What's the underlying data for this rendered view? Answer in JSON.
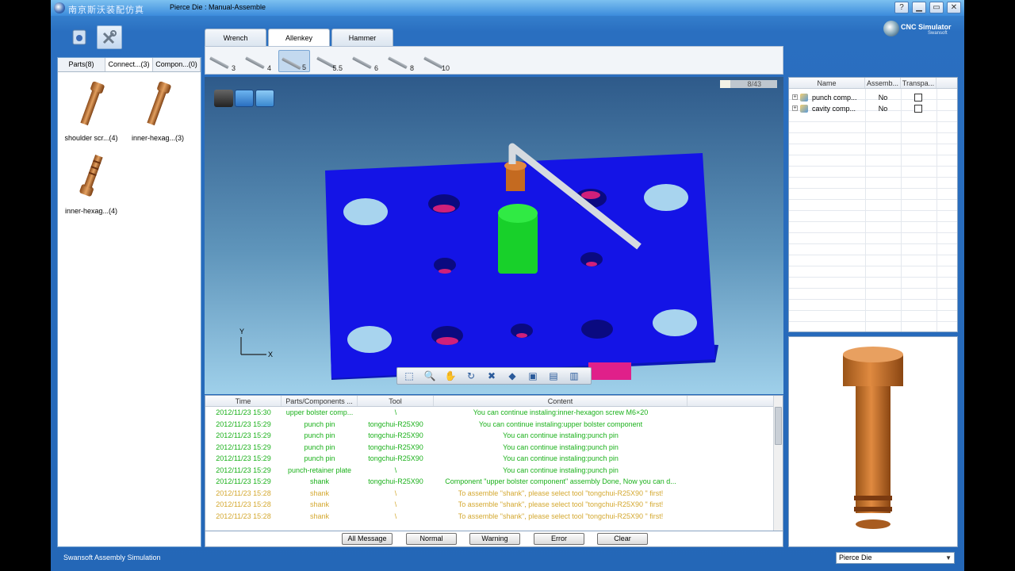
{
  "window": {
    "app_name_cn": "南京斯沃装配仿真",
    "title": "Pierce Die : Manual-Assemble",
    "title_buttons": [
      "help-icon",
      "minimize-icon",
      "maximize-icon",
      "close-icon"
    ]
  },
  "brand": {
    "name": "CNC Simulator",
    "sub": "Swansoft"
  },
  "left_panel": {
    "tabs": [
      {
        "label": "Parts(8)"
      },
      {
        "label": "Connect...(3)"
      },
      {
        "label": "Compon...(0)"
      }
    ],
    "parts": [
      {
        "label": "shoulder scr...(4)"
      },
      {
        "label": "inner-hexag...(3)"
      },
      {
        "label": "inner-hexag...(4)"
      }
    ]
  },
  "tool_tabs": [
    {
      "label": "Wrench"
    },
    {
      "label": "Allenkey"
    },
    {
      "label": "Hammer"
    }
  ],
  "tool_sizes": [
    "3",
    "4",
    "5",
    "5.5",
    "6",
    "8",
    "10"
  ],
  "viewport": {
    "progress": "8/43",
    "progress_fraction": 0.186,
    "axis_y": "Y",
    "axis_x": "X"
  },
  "log": {
    "headers": [
      "Time",
      "Parts/Components ...",
      "Tool",
      "Content"
    ],
    "rows": [
      {
        "time": "2012/11/23 15:30",
        "part": "upper bolster comp...",
        "tool": "\\",
        "content": "You can continue instaling:inner-hexagon screw M6×20",
        "level": "green"
      },
      {
        "time": "2012/11/23 15:29",
        "part": "punch pin",
        "tool": "tongchui-R25X90",
        "content": "You can continue instaling:upper bolster component",
        "level": "green"
      },
      {
        "time": "2012/11/23 15:29",
        "part": "punch pin",
        "tool": "tongchui-R25X90",
        "content": "You can continue instaling:punch pin",
        "level": "green"
      },
      {
        "time": "2012/11/23 15:29",
        "part": "punch pin",
        "tool": "tongchui-R25X90",
        "content": "You can continue instaling:punch pin",
        "level": "green"
      },
      {
        "time": "2012/11/23 15:29",
        "part": "punch pin",
        "tool": "tongchui-R25X90",
        "content": "You can continue instaling:punch pin",
        "level": "green"
      },
      {
        "time": "2012/11/23 15:29",
        "part": "punch-retainer plate",
        "tool": "\\",
        "content": "You can continue instaling:punch pin",
        "level": "green"
      },
      {
        "time": "2012/11/23 15:29",
        "part": "shank",
        "tool": "tongchui-R25X90",
        "content": "Component \"upper bolster component\" assembly Done, Now you can d...",
        "level": "green"
      },
      {
        "time": "2012/11/23 15:28",
        "part": "shank",
        "tool": "\\",
        "content": "To assemble \"shank\", please select tool \"tongchui-R25X90 \" first!",
        "level": "orange"
      },
      {
        "time": "2012/11/23 15:28",
        "part": "shank",
        "tool": "\\",
        "content": "To assemble \"shank\", please select tool \"tongchui-R25X90 \" first!",
        "level": "orange"
      },
      {
        "time": "2012/11/23 15:28",
        "part": "shank",
        "tool": "\\",
        "content": "To assemble \"shank\", please select tool \"tongchui-R25X90 \" first!",
        "level": "orange"
      }
    ],
    "colors": {
      "green": "#1bb11b",
      "orange": "#d4a830"
    }
  },
  "filters": [
    "All Message",
    "Normal",
    "Warning",
    "Error",
    "Clear"
  ],
  "tree": {
    "headers": [
      "Name",
      "Assemb...",
      "Transpa..."
    ],
    "rows": [
      {
        "name": "punch comp...",
        "assembled": "No"
      },
      {
        "name": "cavity comp...",
        "assembled": "No"
      }
    ]
  },
  "status": {
    "text": "Swansoft Assembly Simulation",
    "project": "Pierce Die"
  }
}
